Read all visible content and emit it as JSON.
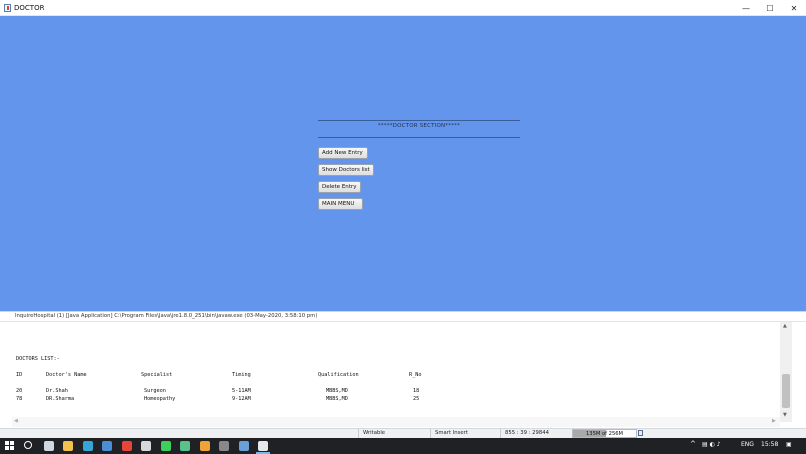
{
  "window": {
    "title": "DOCTOR",
    "minimize_glyph": "—",
    "maximize_glyph": "☐",
    "close_glyph": "✕"
  },
  "doctor_section": {
    "title": "*****DOCTOR SECTION*****",
    "buttons": [
      "Add New Entry",
      "Show Doctors list",
      "Delete Entry",
      "MAIN MENU"
    ],
    "background_color": "#6495ed"
  },
  "console": {
    "header": "InquireHospital (1) [Java Application] C:\\Program Files\\Java\\jre1.8.0_251\\bin\\javaw.exe (03-May-2020, 3:58:10 pm)",
    "list_title": "DOCTORS LIST:-",
    "columns": [
      "ID",
      "Doctor's Name",
      "Specialist",
      "Timing",
      "Qualification",
      "R_No"
    ],
    "rows": [
      [
        "20",
        "Dr.Shah",
        "Surgeon",
        "5-11AM",
        "MBBS,MD",
        "18"
      ],
      [
        "78",
        "DR.Sharma",
        "Homeopathy",
        "9-12AM",
        "MBBS,MD",
        "25"
      ]
    ]
  },
  "statusbar": {
    "writable": "Writable",
    "insert_mode": "Smart Insert",
    "position": "855 : 39 : 29844",
    "heap": "135M of 256M",
    "heap_fraction": 0.527
  },
  "taskbar": {
    "apps": [
      "search-icon",
      "task-view-icon",
      "file-explorer-icon",
      "edge-icon",
      "mail-icon",
      "chrome-icon",
      "store-icon",
      "whatsapp-icon",
      "refresh-icon",
      "eclipse-icon",
      "terminal-icon",
      "media-icon",
      "java-app-icon"
    ],
    "tray_chevron": "^",
    "tray_icons": "▤ ◐ ♪",
    "language": "ENG",
    "time": "15:58",
    "notification_glyph": "▣"
  }
}
